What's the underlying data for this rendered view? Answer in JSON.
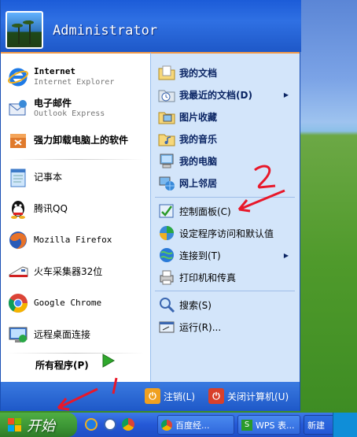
{
  "user": {
    "name": "Administrator"
  },
  "pinned": [
    {
      "title": "Internet",
      "subtitle": "Internet Explorer",
      "icon": "ie-icon"
    },
    {
      "title": "电子邮件",
      "subtitle": "Outlook Express",
      "icon": "outlook-icon"
    },
    {
      "title": "强力卸载电脑上的软件",
      "icon": "uninstall-icon"
    }
  ],
  "recent": [
    {
      "label": "记事本",
      "icon": "notepad-icon"
    },
    {
      "label": "腾讯QQ",
      "icon": "qq-icon"
    },
    {
      "label": "Mozilla Firefox",
      "icon": "firefox-icon"
    },
    {
      "label": "火车采集器32位",
      "icon": "train-icon"
    },
    {
      "label": "Google Chrome",
      "icon": "chrome-icon"
    },
    {
      "label": "远程桌面连接",
      "icon": "remote-desktop-icon"
    }
  ],
  "all_programs": "所有程序(P)",
  "places": [
    {
      "label": "我的文档",
      "icon": "my-documents-icon"
    },
    {
      "label": "我最近的文档(D)",
      "icon": "recent-documents-icon",
      "arrow": true
    },
    {
      "label": "图片收藏",
      "icon": "my-pictures-icon"
    },
    {
      "label": "我的音乐",
      "icon": "my-music-icon"
    },
    {
      "label": "我的电脑",
      "icon": "my-computer-icon"
    },
    {
      "label": "网上邻居",
      "icon": "network-icon"
    }
  ],
  "settings": [
    {
      "label": "控制面板(C)",
      "icon": "control-panel-icon"
    },
    {
      "label": "设定程序访问和默认值",
      "icon": "program-access-icon"
    },
    {
      "label": "连接到(T)",
      "icon": "connect-icon",
      "arrow": true
    },
    {
      "label": "打印机和传真",
      "icon": "printer-icon"
    }
  ],
  "tools": [
    {
      "label": "搜索(S)",
      "icon": "search-icon"
    },
    {
      "label": "运行(R)...",
      "icon": "run-icon"
    }
  ],
  "footer": {
    "logoff": "注销(L)",
    "shutdown": "关闭计算机(U)"
  },
  "taskbar": {
    "start": "开始",
    "buttons": [
      "百度经...",
      "WPS 表...",
      "新建"
    ]
  },
  "annotations": {
    "mark1": "1",
    "mark2": "2"
  },
  "colors": {
    "accent": "#2458d6",
    "start_green": "#3b9434",
    "annotation_red": "#e8182a"
  }
}
